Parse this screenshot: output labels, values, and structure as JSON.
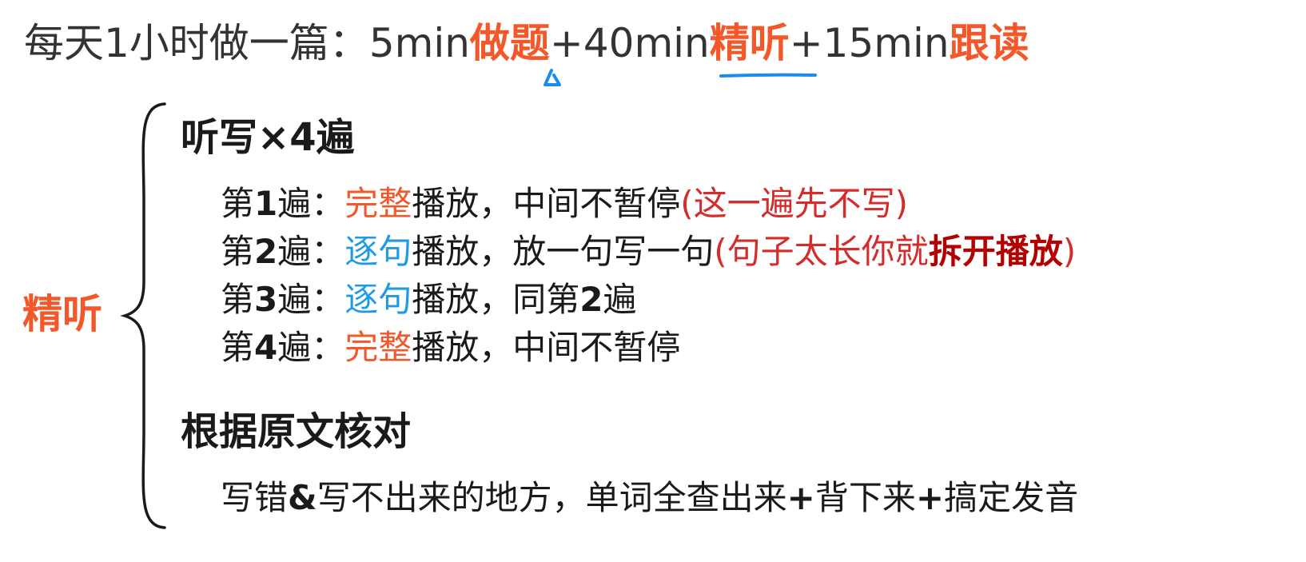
{
  "headline": {
    "prefix": "每天1小时做一篇：",
    "part1_time": "5min",
    "part1_task": "做题",
    "part2_time": "+40min",
    "part2_task": "精听",
    "part3_time": "+15min",
    "part3_task": "跟读",
    "accent_color": "#f2582a"
  },
  "side_label": "精听",
  "section1": {
    "title": "听写×4遍",
    "steps": [
      {
        "prefix": "第",
        "num": "1",
        "suffix": "遍：",
        "highlight": "完整",
        "highlight_color": "orange",
        "rest": "播放，中间不暂停",
        "note": "(这一遍先不写)"
      },
      {
        "prefix": "第",
        "num": "2",
        "suffix": "遍：",
        "highlight": "逐句",
        "highlight_color": "blue",
        "rest": "播放，放一句写一句",
        "note_open": "(句子太长你就",
        "note_bold": "拆开播放",
        "note_close": ")"
      },
      {
        "prefix": "第",
        "num": "3",
        "suffix": "遍：",
        "highlight": "逐句",
        "highlight_color": "blue",
        "rest": "播放，同第",
        "rest_num": "2",
        "rest_end": "遍"
      },
      {
        "prefix": "第",
        "num": "4",
        "suffix": "遍：",
        "highlight": "完整",
        "highlight_color": "orange",
        "rest": "播放，中间不暂停"
      }
    ]
  },
  "section2": {
    "title": "根据原文核对",
    "note_a": "写错",
    "note_amp": "&",
    "note_b": "写不出来的地方，单词全查出来",
    "note_plus1": "+",
    "note_c": "背下来",
    "note_plus2": "+",
    "note_d": "搞定发音"
  },
  "colors": {
    "orange": "#f2582a",
    "blue": "#1f9be6",
    "red": "#d42b2b",
    "dark_red": "#b30000",
    "ink_blue": "#1a8cf0"
  }
}
